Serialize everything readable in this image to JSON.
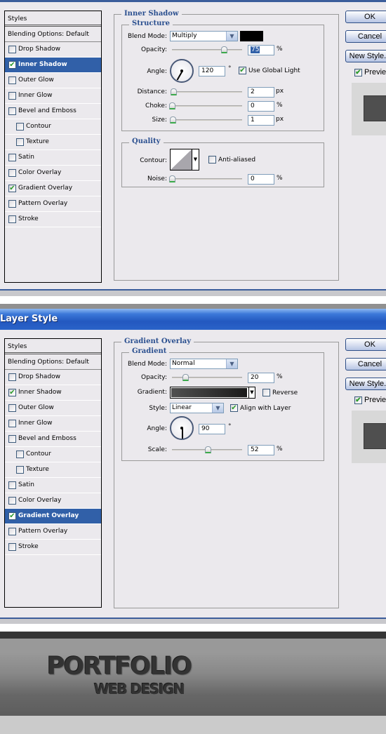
{
  "dialog1": {
    "styles_header": "Styles",
    "blending_options": "Blending Options: Default",
    "styles": [
      {
        "label": "Drop Shadow",
        "checked": false,
        "selected": false,
        "sub": false
      },
      {
        "label": "Inner Shadow",
        "checked": true,
        "selected": true,
        "sub": false
      },
      {
        "label": "Outer Glow",
        "checked": false,
        "selected": false,
        "sub": false
      },
      {
        "label": "Inner Glow",
        "checked": false,
        "selected": false,
        "sub": false
      },
      {
        "label": "Bevel and Emboss",
        "checked": false,
        "selected": false,
        "sub": false
      },
      {
        "label": "Contour",
        "checked": false,
        "selected": false,
        "sub": true
      },
      {
        "label": "Texture",
        "checked": false,
        "selected": false,
        "sub": true
      },
      {
        "label": "Satin",
        "checked": false,
        "selected": false,
        "sub": false
      },
      {
        "label": "Color Overlay",
        "checked": false,
        "selected": false,
        "sub": false
      },
      {
        "label": "Gradient Overlay",
        "checked": true,
        "selected": false,
        "sub": false
      },
      {
        "label": "Pattern Overlay",
        "checked": false,
        "selected": false,
        "sub": false
      },
      {
        "label": "Stroke",
        "checked": false,
        "selected": false,
        "sub": false
      }
    ],
    "section_title": "Inner Shadow",
    "structure_title": "Structure",
    "blend_mode_label": "Blend Mode:",
    "blend_mode": "Multiply",
    "shadow_color": "#000000",
    "opacity_label": "Opacity:",
    "opacity": "75",
    "opacity_fraction": 0.75,
    "angle_label": "Angle:",
    "angle": "120",
    "angle_deg": 120,
    "degree_symbol": "°",
    "use_global_light": "Use Global Light",
    "use_global_light_checked": true,
    "distance_label": "Distance:",
    "distance": "2",
    "choke_label": "Choke:",
    "choke": "0",
    "size_label": "Size:",
    "size": "1",
    "unit_px": "px",
    "unit_pct": "%",
    "quality_title": "Quality",
    "contour_label": "Contour:",
    "anti_aliased": "Anti-aliased",
    "anti_aliased_checked": false,
    "noise_label": "Noise:",
    "noise": "0"
  },
  "dialog2": {
    "window_title": "Layer Style",
    "styles_header": "Styles",
    "blending_options": "Blending Options: Default",
    "styles": [
      {
        "label": "Drop Shadow",
        "checked": false,
        "selected": false,
        "sub": false
      },
      {
        "label": "Inner Shadow",
        "checked": true,
        "selected": false,
        "sub": false
      },
      {
        "label": "Outer Glow",
        "checked": false,
        "selected": false,
        "sub": false
      },
      {
        "label": "Inner Glow",
        "checked": false,
        "selected": false,
        "sub": false
      },
      {
        "label": "Bevel and Emboss",
        "checked": false,
        "selected": false,
        "sub": false
      },
      {
        "label": "Contour",
        "checked": false,
        "selected": false,
        "sub": true
      },
      {
        "label": "Texture",
        "checked": false,
        "selected": false,
        "sub": true
      },
      {
        "label": "Satin",
        "checked": false,
        "selected": false,
        "sub": false
      },
      {
        "label": "Color Overlay",
        "checked": false,
        "selected": false,
        "sub": false
      },
      {
        "label": "Gradient Overlay",
        "checked": true,
        "selected": true,
        "sub": false
      },
      {
        "label": "Pattern Overlay",
        "checked": false,
        "selected": false,
        "sub": false
      },
      {
        "label": "Stroke",
        "checked": false,
        "selected": false,
        "sub": false
      }
    ],
    "section_title": "Gradient Overlay",
    "gradient_title": "Gradient",
    "blend_mode_label": "Blend Mode:",
    "blend_mode": "Normal",
    "opacity_label": "Opacity:",
    "opacity": "20",
    "opacity_fraction": 0.2,
    "gradient_label": "Gradient:",
    "reverse": "Reverse",
    "reverse_checked": false,
    "style_label": "Style:",
    "style": "Linear",
    "align_with_layer": "Align with Layer",
    "align_checked": true,
    "angle_label": "Angle:",
    "angle": "90",
    "angle_deg": 90,
    "degree_symbol": "°",
    "scale_label": "Scale:",
    "scale": "52",
    "scale_fraction": 0.52,
    "unit_pct": "%"
  },
  "buttons": {
    "ok": "OK",
    "cancel": "Cancel",
    "new_style": "New Style...",
    "preview": "Preview",
    "preview_checked": true
  },
  "banner": {
    "title": "PORTFOLIO",
    "subtitle": "WEB DESIGN"
  },
  "colors": {
    "accent": "#3160a8",
    "legend": "#2a4f8f",
    "banner_text": "#333333"
  }
}
